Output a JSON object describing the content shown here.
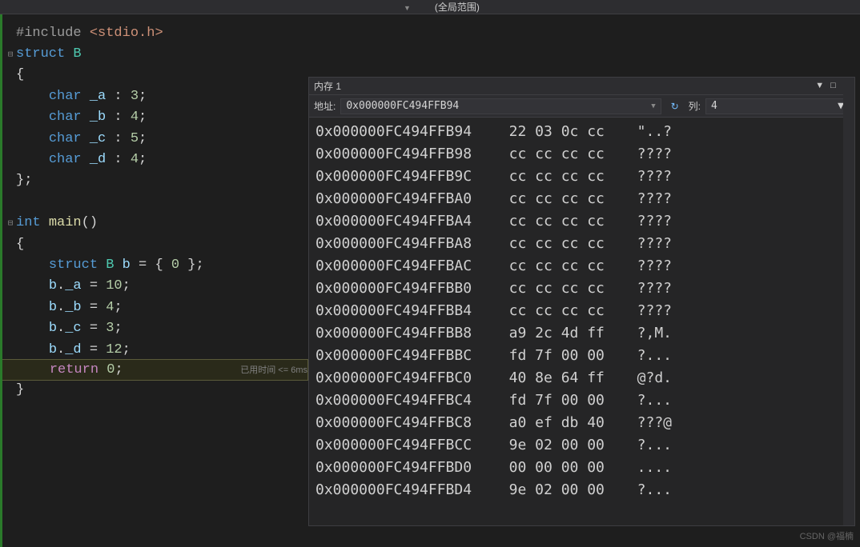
{
  "top_bar": {
    "scope_text": "(全局范围)"
  },
  "code": {
    "lines": [
      {
        "fold": "",
        "html": "<span class='kw-include'>#include</span> <span class='str'>&lt;stdio.h&gt;</span>"
      },
      {
        "fold": "⊟",
        "html": "<span class='kw-blue'>struct</span> <span class='kw-type'>B</span>"
      },
      {
        "fold": "",
        "html": "<span class='punct'>{</span>"
      },
      {
        "fold": "",
        "html": "    <span class='kw-blue'>char</span> <span class='var'>_a</span> : <span class='num'>3</span>;"
      },
      {
        "fold": "",
        "html": "    <span class='kw-blue'>char</span> <span class='var'>_b</span> : <span class='num'>4</span>;"
      },
      {
        "fold": "",
        "html": "    <span class='kw-blue'>char</span> <span class='var'>_c</span> : <span class='num'>5</span>;"
      },
      {
        "fold": "",
        "html": "    <span class='kw-blue'>char</span> <span class='var'>_d</span> : <span class='num'>4</span>;"
      },
      {
        "fold": "",
        "html": "<span class='punct'>};</span>"
      },
      {
        "fold": "",
        "html": ""
      },
      {
        "fold": "⊟",
        "html": "<span class='kw-blue'>int</span> <span class='fn'>main</span>()"
      },
      {
        "fold": "",
        "html": "<span class='punct'>{</span>"
      },
      {
        "fold": "",
        "html": "    <span class='kw-blue'>struct</span> <span class='kw-type'>B</span> <span class='var'>b</span> = { <span class='num'>0</span> };"
      },
      {
        "fold": "",
        "html": "    <span class='var'>b</span>.<span class='var'>_a</span> = <span class='num'>10</span>;"
      },
      {
        "fold": "",
        "html": "    <span class='var'>b</span>.<span class='var'>_b</span> = <span class='num'>4</span>;"
      },
      {
        "fold": "",
        "html": "    <span class='var'>b</span>.<span class='var'>_c</span> = <span class='num'>3</span>;"
      },
      {
        "fold": "",
        "html": "    <span class='var'>b</span>.<span class='var'>_d</span> = <span class='num'>12</span>;"
      },
      {
        "fold": "",
        "html": "    <span class='kw-purple'>return</span> <span class='num'>0</span>;",
        "highlight": true,
        "hint": "已用时间 <= 6ms"
      },
      {
        "fold": "",
        "html": "<span class='punct'>}</span>"
      }
    ]
  },
  "memory": {
    "title": "内存 1",
    "addr_label": "地址:",
    "addr_value": "0x000000FC494FFB94",
    "col_label": "列:",
    "col_value": "4",
    "rows": [
      {
        "addr": "0x000000FC494FFB94",
        "hex": "22 03 0c cc",
        "ascii": "\"..?"
      },
      {
        "addr": "0x000000FC494FFB98",
        "hex": "cc cc cc cc",
        "ascii": "????"
      },
      {
        "addr": "0x000000FC494FFB9C",
        "hex": "cc cc cc cc",
        "ascii": "????"
      },
      {
        "addr": "0x000000FC494FFBA0",
        "hex": "cc cc cc cc",
        "ascii": "????"
      },
      {
        "addr": "0x000000FC494FFBA4",
        "hex": "cc cc cc cc",
        "ascii": "????"
      },
      {
        "addr": "0x000000FC494FFBA8",
        "hex": "cc cc cc cc",
        "ascii": "????"
      },
      {
        "addr": "0x000000FC494FFBAC",
        "hex": "cc cc cc cc",
        "ascii": "????"
      },
      {
        "addr": "0x000000FC494FFBB0",
        "hex": "cc cc cc cc",
        "ascii": "????"
      },
      {
        "addr": "0x000000FC494FFBB4",
        "hex": "cc cc cc cc",
        "ascii": "????"
      },
      {
        "addr": "0x000000FC494FFBB8",
        "hex": "a9 2c 4d ff",
        "ascii": "?,M."
      },
      {
        "addr": "0x000000FC494FFBBC",
        "hex": "fd 7f 00 00",
        "ascii": "?..."
      },
      {
        "addr": "0x000000FC494FFBC0",
        "hex": "40 8e 64 ff",
        "ascii": "@?d."
      },
      {
        "addr": "0x000000FC494FFBC4",
        "hex": "fd 7f 00 00",
        "ascii": "?..."
      },
      {
        "addr": "0x000000FC494FFBC8",
        "hex": "a0 ef db 40",
        "ascii": "???@"
      },
      {
        "addr": "0x000000FC494FFBCC",
        "hex": "9e 02 00 00",
        "ascii": "?..."
      },
      {
        "addr": "0x000000FC494FFBD0",
        "hex": "00 00 00 00",
        "ascii": "...."
      },
      {
        "addr": "0x000000FC494FFBD4",
        "hex": "9e 02 00 00",
        "ascii": "?..."
      }
    ]
  },
  "watermark": "CSDN @福楠"
}
